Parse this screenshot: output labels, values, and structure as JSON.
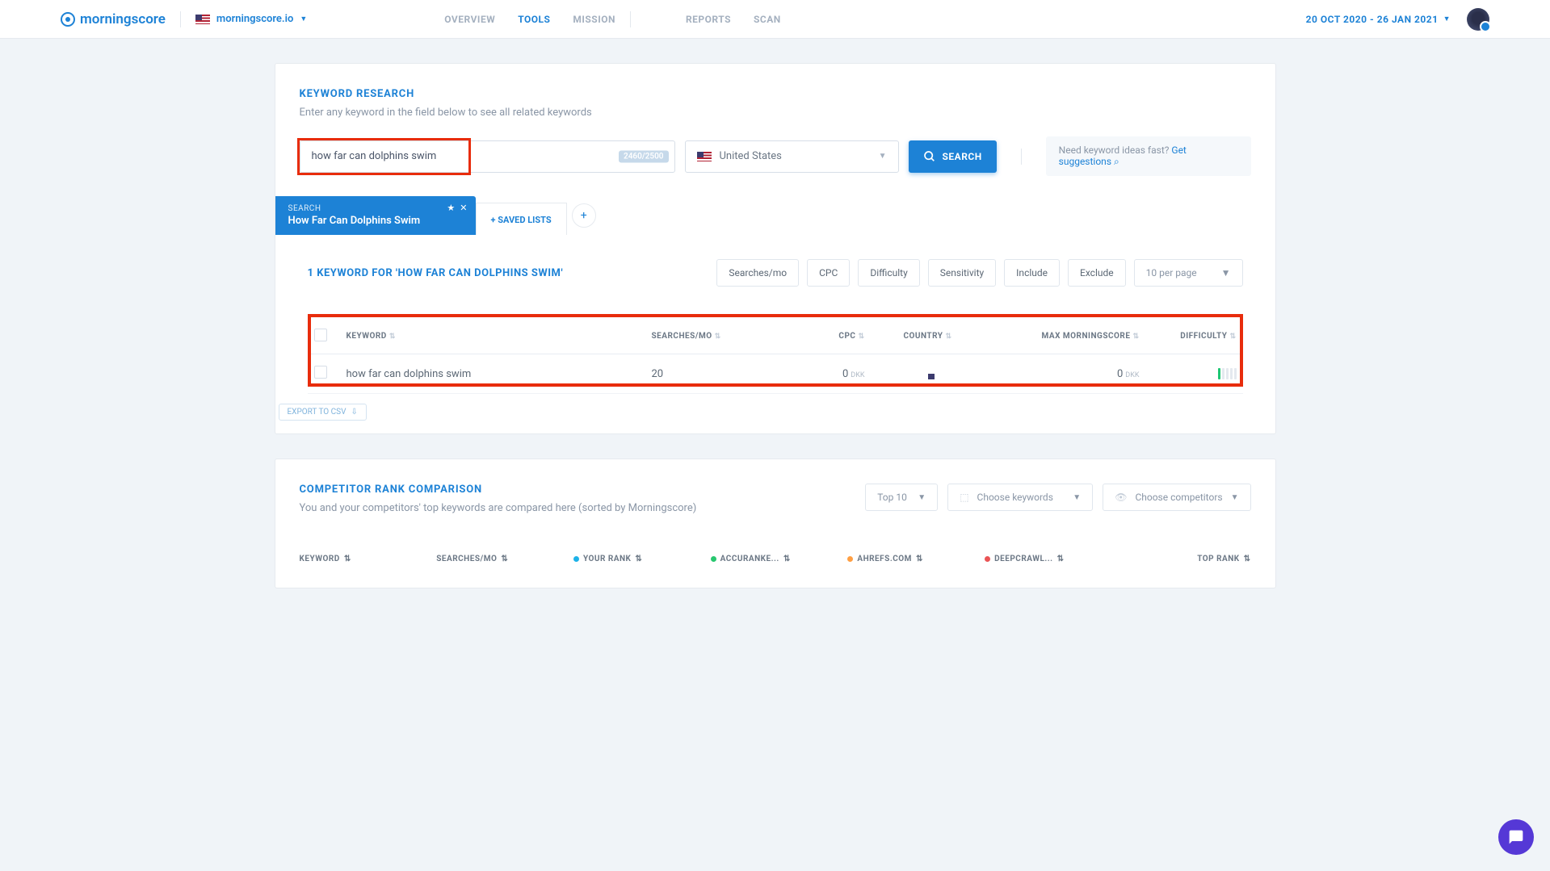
{
  "header": {
    "brand": "morningscore",
    "domain": "morningscore.io",
    "nav_center": [
      "OVERVIEW",
      "TOOLS",
      "MISSION"
    ],
    "nav_right": [
      "REPORTS",
      "SCAN"
    ],
    "date_range": "20 OCT 2020 - 26 JAN 2021"
  },
  "research": {
    "title": "KEYWORD RESEARCH",
    "subtitle": "Enter any keyword in the field below to see all related keywords",
    "input_value": "how far can dolphins swim",
    "counter": "2460/2500",
    "country": "United States",
    "search_btn": "SEARCH",
    "ideas_text": "Need keyword ideas fast? ",
    "ideas_link": "Get suggestions"
  },
  "tabs": {
    "search_label": "SEARCH",
    "search_value": "How Far Can Dolphins Swim",
    "saved": "+ SAVED LISTS"
  },
  "results": {
    "title": "1 KEYWORD FOR 'HOW FAR CAN DOLPHINS SWIM'",
    "filters": [
      "Searches/mo",
      "CPC",
      "Difficulty",
      "Sensitivity",
      "Include",
      "Exclude"
    ],
    "per_page": "10 per page",
    "columns": {
      "keyword": "KEYWORD",
      "searches": "SEARCHES/MO",
      "cpc": "CPC",
      "country": "COUNTRY",
      "max": "MAX MORNINGSCORE",
      "difficulty": "DIFFICULTY"
    },
    "rows": [
      {
        "keyword": "how far can dolphins swim",
        "searches": "20",
        "cpc": "0",
        "cpc_cur": "DKK",
        "max": "0",
        "max_cur": "DKK"
      }
    ],
    "export": "EXPORT TO CSV"
  },
  "comp": {
    "title": "COMPETITOR RANK COMPARISON",
    "subtitle": "You and your competitors' top keywords are compared here (sorted by Morningscore)",
    "filters": {
      "top": "Top 10",
      "kw": "Choose keywords",
      "comp": "Choose competitors"
    },
    "cols": {
      "keyword": "KEYWORD",
      "searches": "SEARCHES/MO",
      "your": "YOUR RANK",
      "c1": "ACCURANKE...",
      "c2": "AHREFS.COM",
      "c3": "DEEPCRAWL...",
      "top": "TOP RANK"
    }
  }
}
